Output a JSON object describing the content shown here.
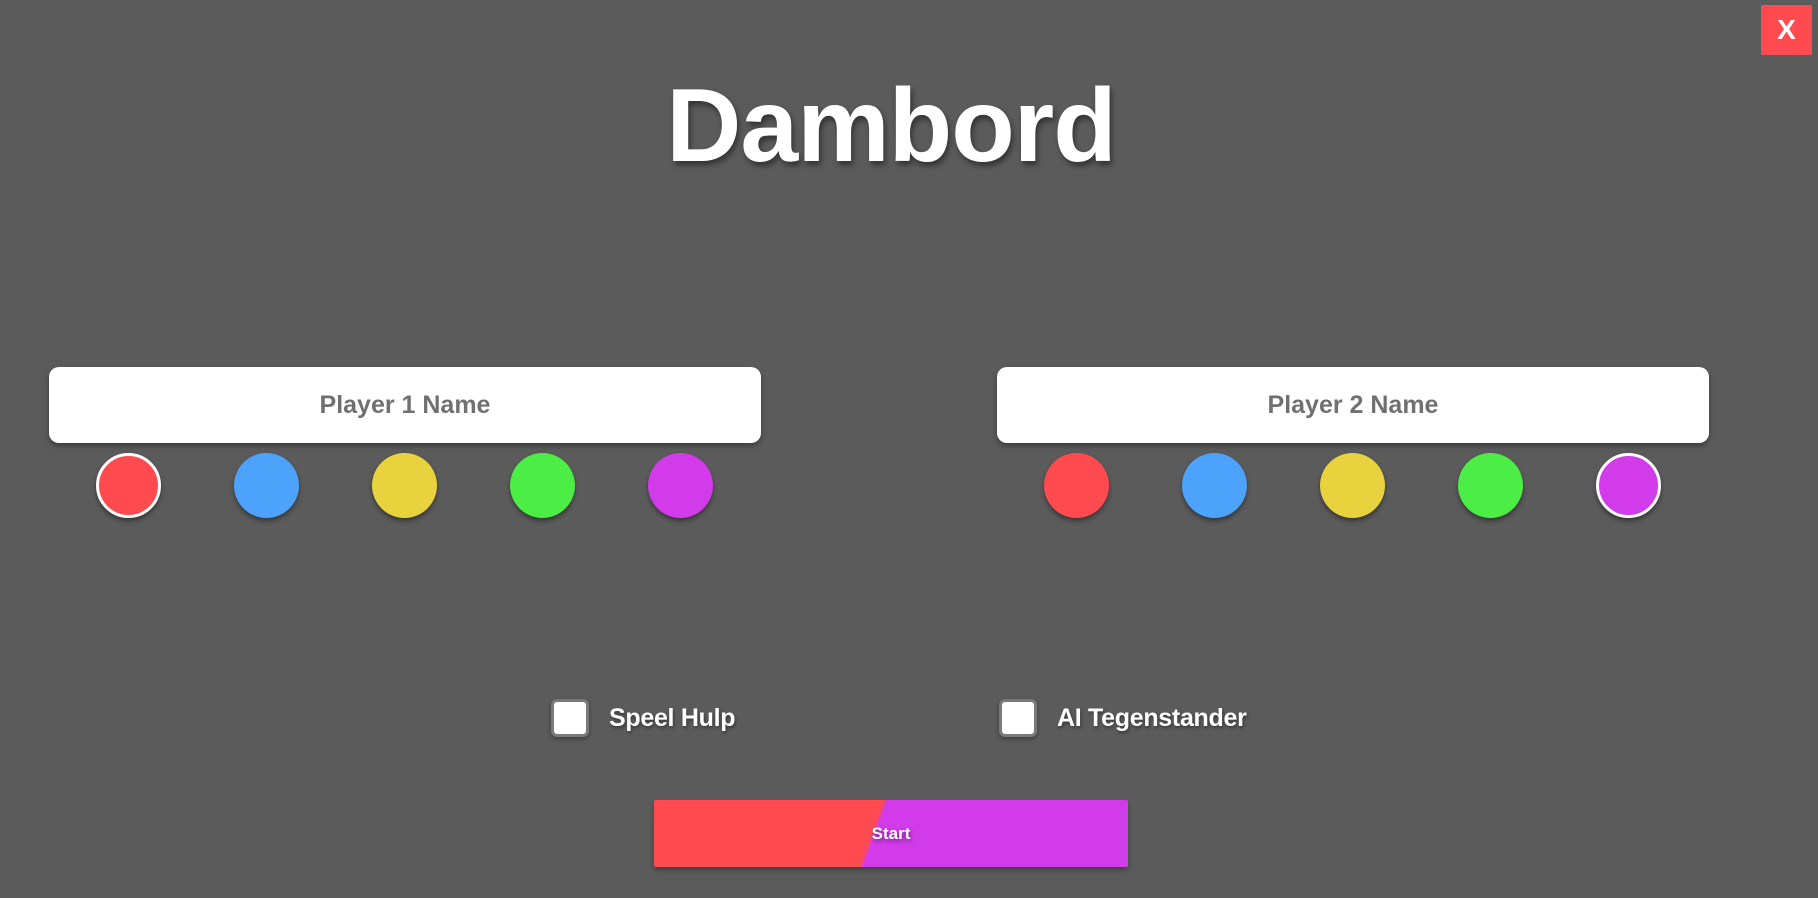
{
  "window": {
    "close_label": "X"
  },
  "title": "Dambord",
  "colors": {
    "background": "#5b5b5b",
    "close_button": "#ff4b50",
    "input_text": "#707070"
  },
  "swatch_colors": [
    "#ff4b50",
    "#4da3fb",
    "#e8d23e",
    "#4ced44",
    "#d13be9"
  ],
  "player1": {
    "value": "",
    "placeholder": "Player 1 Name",
    "selected_color": "#ff4b50",
    "selected_index": 0
  },
  "player2": {
    "value": "",
    "placeholder": "Player 2 Name",
    "selected_color": "#d13be9",
    "selected_index": 4
  },
  "options": {
    "help_label": "Speel Hulp",
    "help_checked": false,
    "ai_label": "AI Tegenstander",
    "ai_checked": false
  },
  "start_label": "Start"
}
